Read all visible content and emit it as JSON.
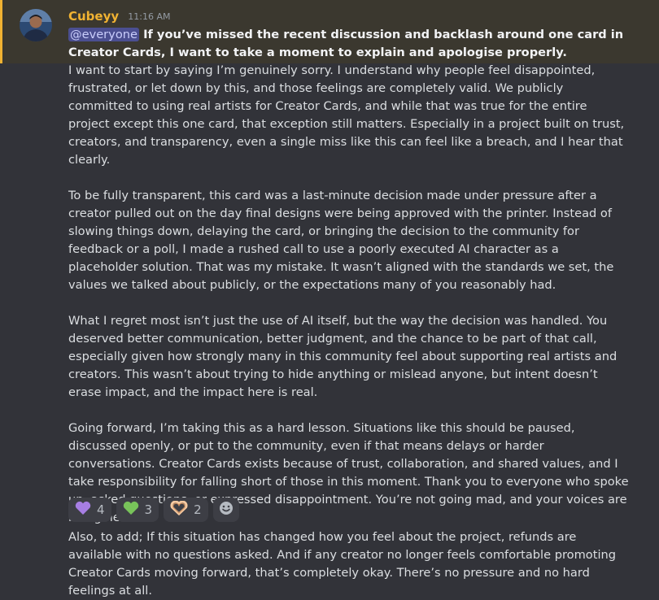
{
  "message": {
    "author": "Cubeyy",
    "timestamp": "11:16 AM",
    "mention": "@everyone",
    "headline": " If you’ve missed the recent discussion and backlash around one card in Creator Cards, I want to take a moment to explain and apologise properly.",
    "paragraphs": [
      "I want to start by saying I’m genuinely sorry. I understand why people feel disappointed, frustrated, or let down by this, and those feelings are completely valid. We publicly committed to using real artists for Creator Cards, and while that was true for the entire project except this one card, that exception still matters. Especially in a project built on trust, creators, and transparency, even a single miss like this can feel like a breach, and I hear that clearly.",
      "To be fully transparent, this card was a last-minute decision made under pressure after a creator pulled out on the day final designs were being approved with the printer. Instead of slowing things down, delaying the card, or bringing the decision to the community for feedback or a poll, I made a rushed call to use a poorly executed AI character as a placeholder solution. That was my mistake. It wasn’t aligned with the standards we set, the values we talked about publicly, or the expectations many of you reasonably had.",
      "What I regret most isn’t just the use of AI itself, but the way the decision was handled. You deserved better communication, better judgment, and the chance to be part of that call, especially given how strongly many in this community feel about supporting real artists and creators. This wasn’t about trying to hide anything or mislead anyone, but intent doesn’t erase impact, and the impact here is real.",
      "Going forward, I’m taking this as a hard lesson. Situations like this should be paused, discussed openly, or put to the community, even if that means delays or harder conversations. Creator Cards exists because of trust, collaboration, and shared values, and I take responsibility for falling short of those in this moment. Thank you to everyone who spoke up, asked questions, or expressed disappointment. You’re not going mad, and your voices are being heard."
    ],
    "reactions": [
      {
        "emoji": "purple-heart",
        "count": "4",
        "color": "#a77ee3"
      },
      {
        "emoji": "green-heart",
        "count": "3",
        "color": "#78c35a"
      },
      {
        "emoji": "heart-hands",
        "count": "2",
        "color": "#f2f3f5"
      }
    ],
    "followup": "Also, to add; If this situation has changed how you feel about the project, refunds are available with no questions asked. And if any creator no longer feels comfortable promoting Creator Cards moving forward, that’s completely okay. There’s no pressure and no hard feelings at all."
  },
  "colors": {
    "background": "#323339",
    "highlight": "#3b382f",
    "mention_bar": "#f0b232",
    "author": "#f0b232",
    "mention_bg": "#4b4f91"
  }
}
